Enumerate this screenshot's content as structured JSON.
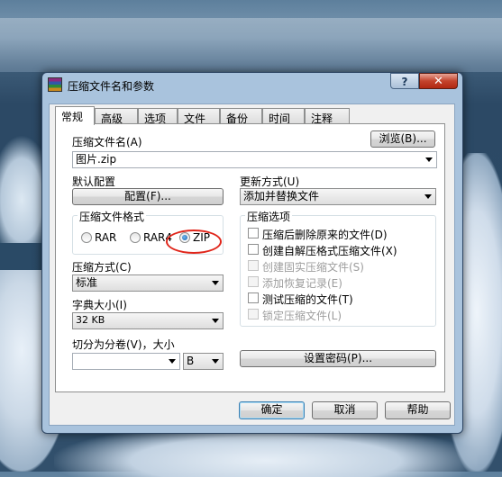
{
  "dialog": {
    "title": "压缩文件名和参数",
    "help_glyph": "?",
    "close_glyph": "✕"
  },
  "tabs": [
    "常规",
    "高级",
    "选项",
    "文件",
    "备份",
    "时间",
    "注释"
  ],
  "general": {
    "archive_name_label": "压缩文件名(A)",
    "browse_button": "浏览(B)...",
    "archive_name_value": "图片.zip",
    "default_profile_label": "默认配置",
    "profiles_button": "配置(F)...",
    "update_mode_label": "更新方式(U)",
    "update_mode_value": "添加并替换文件",
    "format_group_title": "压缩文件格式",
    "formats": [
      {
        "label": "RAR",
        "selected": false
      },
      {
        "label": "RAR4",
        "selected": false
      },
      {
        "label": "ZIP",
        "selected": true
      }
    ],
    "method_label": "压缩方式(C)",
    "method_value": "标准",
    "dict_label": "字典大小(I)",
    "dict_value": "32 KB",
    "split_label": "切分为分卷(V)，大小",
    "split_value": "",
    "split_unit": "B",
    "options_group_title": "压缩选项",
    "options": [
      {
        "label": "压缩后删除原来的文件(D)",
        "checked": false,
        "enabled": true
      },
      {
        "label": "创建自解压格式压缩文件(X)",
        "checked": false,
        "enabled": true
      },
      {
        "label": "创建固实压缩文件(S)",
        "checked": false,
        "enabled": false
      },
      {
        "label": "添加恢复记录(E)",
        "checked": false,
        "enabled": false
      },
      {
        "label": "测试压缩的文件(T)",
        "checked": false,
        "enabled": true
      },
      {
        "label": "锁定压缩文件(L)",
        "checked": false,
        "enabled": false
      }
    ],
    "password_button": "设置密码(P)..."
  },
  "footer": {
    "ok": "确定",
    "cancel": "取消",
    "help": "帮助"
  },
  "colors": {
    "highlight_ring": "#e0261b",
    "close_button": "#c4432c"
  }
}
